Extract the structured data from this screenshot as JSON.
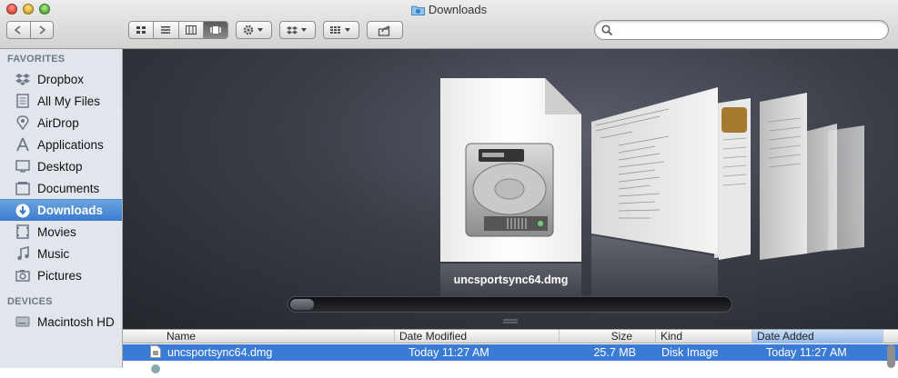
{
  "window": {
    "title": "Downloads"
  },
  "toolbar": {
    "back_label": "◀",
    "forward_label": "▶"
  },
  "search": {
    "value": "",
    "placeholder": ""
  },
  "sidebar": {
    "favorites_header": "FAVORITES",
    "devices_header": "DEVICES",
    "favorites": [
      {
        "label": "Dropbox",
        "icon": "dropbox-icon"
      },
      {
        "label": "All My Files",
        "icon": "all-files-icon"
      },
      {
        "label": "AirDrop",
        "icon": "airdrop-icon"
      },
      {
        "label": "Applications",
        "icon": "applications-icon"
      },
      {
        "label": "Desktop",
        "icon": "desktop-icon"
      },
      {
        "label": "Documents",
        "icon": "documents-icon"
      },
      {
        "label": "Downloads",
        "icon": "downloads-icon",
        "selected": true
      },
      {
        "label": "Movies",
        "icon": "movies-icon"
      },
      {
        "label": "Music",
        "icon": "music-icon"
      },
      {
        "label": "Pictures",
        "icon": "pictures-icon"
      }
    ],
    "devices": [
      {
        "label": "Macintosh HD",
        "icon": "hard-drive-icon"
      }
    ]
  },
  "coverflow": {
    "selected_name": "uncsportsync64.dmg"
  },
  "list": {
    "columns": [
      "Name",
      "Date Modified",
      "Size",
      "Kind",
      "Date Added"
    ],
    "sorted_column": "Date Added",
    "rows": [
      {
        "name": "uncsportsync64.dmg",
        "modified": "Today 11:27 AM",
        "size": "25.7 MB",
        "kind": "Disk Image",
        "added": "Today 11:27 AM",
        "selected": true
      }
    ]
  },
  "colors": {
    "selection": "#3a7bd5",
    "sidebar_bg": "#e1e6ed",
    "coverflow_bg": "#2e3038"
  }
}
